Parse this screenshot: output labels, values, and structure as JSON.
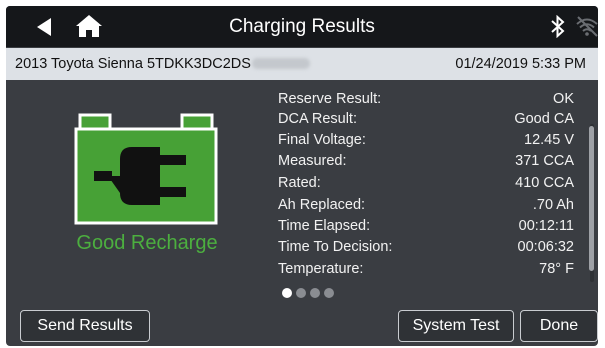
{
  "header": {
    "title": "Charging Results",
    "back_icon": "back-arrow-icon",
    "home_icon": "home-icon",
    "bluetooth_icon": "bluetooth-icon",
    "wifi_icon": "wifi-off-icon"
  },
  "vehicle_bar": {
    "vehicle": "2013 Toyota Sienna  5TDKK3DC2DS",
    "datetime": "01/24/2019 5:33 PM"
  },
  "summary": {
    "icon": "battery-plug-icon",
    "status": "Good Recharge",
    "status_color": "#4caf3f"
  },
  "results": [
    {
      "label": "Reserve Result:",
      "value": "OK"
    },
    {
      "label": "DCA Result:",
      "value": "Good CA"
    },
    {
      "label": "Final Voltage:",
      "value": "12.45 V"
    },
    {
      "label": "Measured:",
      "value": "371 CCA"
    },
    {
      "label": "Rated:",
      "value": "410 CCA"
    },
    {
      "label": "Ah Replaced:",
      "value": ".70 Ah"
    },
    {
      "label": "Time Elapsed:",
      "value": "00:12:11"
    },
    {
      "label": "Time To Decision:",
      "value": "00:06:32"
    },
    {
      "label": "Temperature:",
      "value": "78° F"
    }
  ],
  "pagination": {
    "total": 4,
    "active": 1
  },
  "buttons": {
    "send": "Send Results",
    "system_test": "System Test",
    "done": "Done"
  }
}
